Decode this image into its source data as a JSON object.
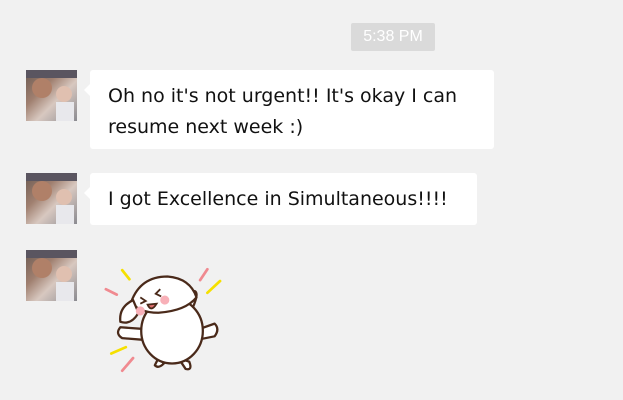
{
  "timestamp": "5:38 PM",
  "messages": [
    {
      "type": "text",
      "sender": "contact",
      "text": "Oh no it's not urgent!! It's okay I can resume next week :)"
    },
    {
      "type": "text",
      "sender": "contact",
      "text": "I got Excellence in Simultaneous!!!!"
    },
    {
      "type": "sticker",
      "sender": "contact",
      "sticker": "happy-white-puppy-dancing"
    }
  ],
  "colors": {
    "background": "#f1f1f1",
    "bubble": "#ffffff",
    "timestamp_bg": "#dadada"
  }
}
